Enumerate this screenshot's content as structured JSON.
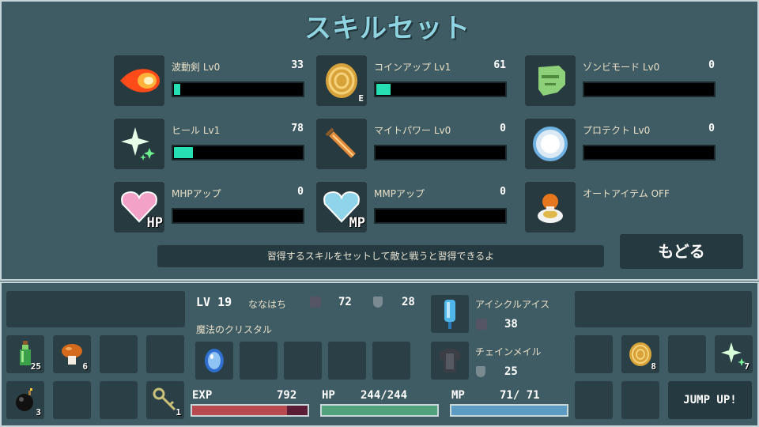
{
  "title": "スキルセット",
  "skills": [
    {
      "name": "波動剣 Lv0",
      "level": "33",
      "progress": 0.05,
      "icon": "fireball-icon"
    },
    {
      "name": "コインアップ Lv1",
      "level": "61",
      "progress": 0.11,
      "icon": "coin-icon",
      "badge": "E"
    },
    {
      "name": "ゾンビモード Lv0",
      "level": "0",
      "progress": 0,
      "icon": "zombie-icon"
    },
    {
      "name": "ヒール Lv1",
      "level": "78",
      "progress": 0.15,
      "icon": "sparkle-icon"
    },
    {
      "name": "マイトパワー Lv0",
      "level": "0",
      "progress": 0,
      "icon": "sword-icon"
    },
    {
      "name": "プロテクト Lv0",
      "level": "0",
      "progress": 0,
      "icon": "shield-ring-icon"
    },
    {
      "name": "MHPアップ",
      "level": "0",
      "progress": 0,
      "icon": "heart-hp-icon",
      "badge": "HP"
    },
    {
      "name": "MMPアップ",
      "level": "0",
      "progress": 0,
      "icon": "heart-mp-icon",
      "badge": "MP"
    },
    {
      "name": "オートアイテム OFF",
      "icon": "auto-item-icon"
    }
  ],
  "hint": "習得するスキルをセットして敵と戦うと習得できるよ",
  "back_label": "もどる",
  "player": {
    "level_label": "LV",
    "level": "19",
    "name": "ななはち",
    "attack": "72",
    "defense": "28",
    "crystal_label": "魔法のクリスタル"
  },
  "equipment": {
    "weapon": {
      "name": "アイシクルアイス",
      "value": "38"
    },
    "armor": {
      "name": "チェインメイル",
      "value": "25"
    }
  },
  "inventory_left": [
    {
      "icon": "potion-icon",
      "count": "25"
    },
    {
      "icon": "mushroom-icon",
      "count": "6"
    },
    {
      "icon": "bomb-icon",
      "count": "3"
    },
    {
      "icon": "key-icon",
      "count": "1"
    }
  ],
  "inventory_right": [
    {
      "icon": "coin-icon",
      "count": "8"
    },
    {
      "icon": "sparkle-icon",
      "count": "7"
    }
  ],
  "gauges": {
    "exp": {
      "label": "EXP",
      "value": "792",
      "fraction": 0.82,
      "color": "#b8494f"
    },
    "hp": {
      "label": "HP",
      "value": "244/244",
      "fraction": 1.0,
      "color": "#4fa27a"
    },
    "mp": {
      "label": "MP",
      "value": "71/ 71",
      "fraction": 1.0,
      "color": "#5d9cc2"
    }
  },
  "jump_label": "JUMP UP!"
}
